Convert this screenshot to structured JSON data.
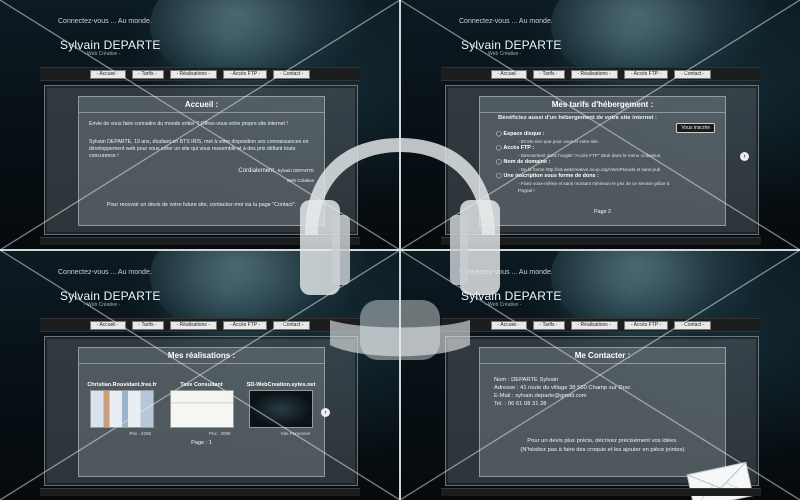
{
  "site": {
    "tagline": "Connectez-vous ... Au monde.",
    "brand_name": "Sylvain DEPARTE",
    "brand_sub": "- Web Créative -"
  },
  "nav": [
    "- Accueil -",
    "- Tarifs -",
    "- Réalisations -",
    "- Accès FTP -",
    "- Contact -"
  ],
  "accueil": {
    "title": "Accueil :",
    "p1": "Envie de vous faire connaitre du monde entier ? Offrez-vous votre propre site internet !",
    "p2": "Sylvain DEPARTE, 19 ans, étudiant en BTS IRIS, met à votre disposition ses connaissances en développement web pour vous créer un site qui vous  ressemble et à des prix défiant toute concurence !",
    "sign1": "Cordialement,",
    "sign_name": "Sylvain DEPARTE",
    "sign2": "Web Créative",
    "p3": "Pour recevoir un devis de votre future site, contactez-moi via la page \"Contact\"."
  },
  "tarifs": {
    "title": "Mes tarifs d'hébergement :",
    "intro": "Bénéficiez aussi d'un hébergement de votre site internet :",
    "button": "Vous inscrire",
    "items": [
      {
        "head": "Espace disque :",
        "sub": "- 50 Mo rien que pour vous et votre site."
      },
      {
        "head": "Accès FTP :",
        "sub": "- Directement dans l'onglet \"Accès FTP\" situé dans le menu ci-dessus."
      },
      {
        "head": "Nom de domaine :",
        "sub": "- De la forme http://sd-webcreative.no-ip.org/VotrePseudo et sans pub"
      },
      {
        "head": "Une inscription sous forme de dons :",
        "sub": "- Fixez vous-même et sans montant minimum le prix de ce service grâce à Paypal !"
      }
    ],
    "page": "Page 2"
  },
  "realisations": {
    "title": "Mes réalisations :",
    "items": [
      {
        "name": "Christian.Rouvidant.free.fr",
        "caption": "Prix : 425€"
      },
      {
        "name": "Taxe Consultant",
        "caption": "Prix : 300€"
      },
      {
        "name": "SD-WebCreation.sytes.net",
        "caption": "Site Personnel"
      }
    ],
    "page": "Page : 1"
  },
  "contact": {
    "title": "Me Contacter :",
    "name_line": "Nom : DEPARTE Sylvain",
    "address_line": "Adresse : 41 route du village 38 560 Champ sur Drac",
    "email_line": "E-Mail : sylvain.departe@gmail.com",
    "tel_line": "Tel. : 06 61 08 31 28",
    "note1": "Pour un devis plus précis, décrivez précisément vos idées.",
    "note2": "(N'hésitez pas à faire des croquis et les ajouter en pièce jointes)"
  },
  "colors": {
    "separator": "#cfd6da",
    "nav_button": "#e7e9ea",
    "headphone_overlay": "#e6eaec"
  },
  "icons": [
    "headphones-icon",
    "envelope-icon",
    "chevron-right-icon"
  ]
}
